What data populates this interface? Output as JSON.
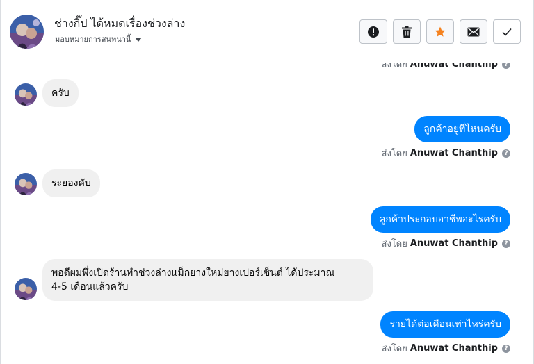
{
  "header": {
    "title": "ช่างกิ๊ป ได้หมดเรื่องช่วงล่าง",
    "subtitle": "มอบหมายการสนทนานี้",
    "avatar_icon": "profile-photo",
    "actions": [
      {
        "name": "report",
        "icon": "exclamation-circle-icon"
      },
      {
        "name": "delete",
        "icon": "trash-icon"
      },
      {
        "name": "star",
        "icon": "star-icon",
        "color": "#f5821f"
      },
      {
        "name": "mail",
        "icon": "envelope-icon"
      },
      {
        "name": "done",
        "icon": "checkmark-icon"
      }
    ]
  },
  "thread": {
    "sent_prefix": "ส่งโดย",
    "sender_name": "Anuwat Chanthip",
    "help_glyph": "?",
    "messages": [
      {
        "dir": "in",
        "text": "ครับ"
      },
      {
        "dir": "out",
        "text": "ลูกค้าอยู่ที่ไหนครับ"
      },
      {
        "dir": "in",
        "text": "ระยองคับ"
      },
      {
        "dir": "out",
        "text": "ลูกค้าประกอบอาชีพอะไรครับ"
      },
      {
        "dir": "in",
        "line1": "พอดีผมพึ่งเปิดร้านทำช่วงล่างแม็กยางใหม่ยางเปอร์เซ็นต์ ได้ประมาณ",
        "line2": "4-5 เดือนแล้วครับ"
      },
      {
        "dir": "out",
        "text": "รายได้ต่อเดือนเท่าไหร่ครับ"
      }
    ]
  },
  "colors": {
    "outgoing_bubble": "#0084ff",
    "incoming_bubble": "#f0f0f0",
    "accent_star": "#f5821f"
  }
}
